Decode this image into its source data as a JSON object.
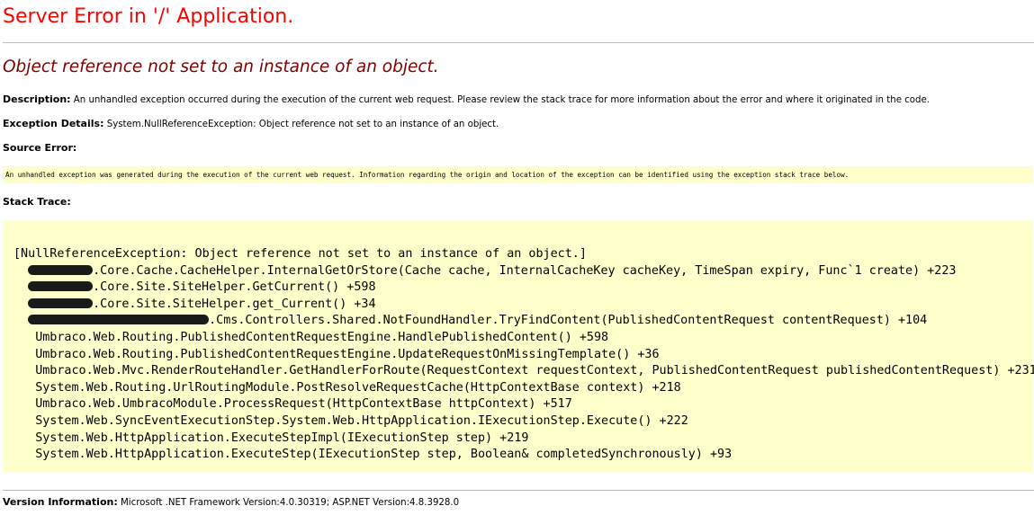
{
  "page": {
    "title": "Server Error in '/' Application.",
    "subtitle": "Object reference not set to an instance of an object."
  },
  "description": {
    "label": "Description:",
    "text": "An unhandled exception occurred during the execution of the current web request. Please review the stack trace for more information about the error and where it originated in the code."
  },
  "exception_details": {
    "label": "Exception Details:",
    "text": "System.NullReferenceException: Object reference not set to an instance of an object."
  },
  "source_error": {
    "label": "Source Error:",
    "text": "An unhandled exception was generated during the execution of the current web request. Information regarding the origin and location of the exception can be identified using the exception stack trace below."
  },
  "stack_trace": {
    "label": "Stack Trace:",
    "lines": [
      "[NullReferenceException: Object reference not set to an instance of an object.]",
      ".Core.Cache.CacheHelper.InternalGetOrStore(Cache cache, InternalCacheKey cacheKey, TimeSpan expiry, Func`1 create) +223",
      ".Core.Site.SiteHelper.GetCurrent() +598",
      ".Core.Site.SiteHelper.get_Current() +34",
      ".Cms.Controllers.Shared.NotFoundHandler.TryFindContent(PublishedContentRequest contentRequest) +104",
      "Umbraco.Web.Routing.PublishedContentRequestEngine.HandlePublishedContent() +598",
      "Umbraco.Web.Routing.PublishedContentRequestEngine.UpdateRequestOnMissingTemplate() +36",
      "Umbraco.Web.Mvc.RenderRouteHandler.GetHandlerForRoute(RequestContext requestContext, PublishedContentRequest publishedContentRequest) +231",
      "System.Web.Routing.UrlRoutingModule.PostResolveRequestCache(HttpContextBase context) +218",
      "Umbraco.Web.UmbracoModule.ProcessRequest(HttpContextBase httpContext) +517",
      "System.Web.SyncEventExecutionStep.System.Web.HttpApplication.IExecutionStep.Execute() +222",
      "System.Web.HttpApplication.ExecuteStepImpl(IExecutionStep step) +219",
      "System.Web.HttpApplication.ExecuteStep(IExecutionStep step, Boolean& completedSynchronously) +93"
    ]
  },
  "version_information": {
    "label": "Version Information:",
    "text": "Microsoft .NET Framework Version:4.0.30319; ASP.NET Version:4.8.3928.0"
  }
}
